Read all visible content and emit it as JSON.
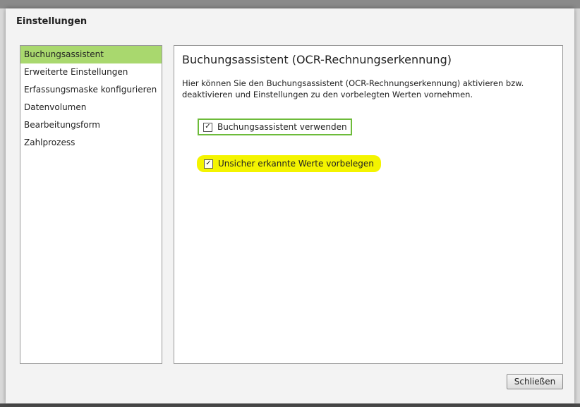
{
  "dialog": {
    "title": "Einstellungen"
  },
  "nav": {
    "items": [
      {
        "label": "Buchungsassistent",
        "active": true
      },
      {
        "label": "Erweiterte Einstellungen"
      },
      {
        "label": "Erfassungsmaske konfigurieren"
      },
      {
        "label": "Datenvolumen"
      },
      {
        "label": "Bearbeitungsform"
      },
      {
        "label": "Zahlprozess"
      }
    ]
  },
  "content": {
    "title": "Buchungsassistent (OCR-Rechnungserkennung)",
    "description": "Hier können Sie den Buchungsassistent (OCR-Rechnungserkennung) aktivieren bzw. deaktivieren und Einstellungen zu den vorbelegten Werten vornehmen.",
    "options": [
      {
        "label": "Buchungsassistent verwenden",
        "checked": true,
        "check_glyph": "✓"
      },
      {
        "label": "Unsicher erkannte Werte vorbelegen",
        "checked": true,
        "check_glyph": "✓"
      }
    ]
  },
  "footer": {
    "close_label": "Schließen"
  },
  "colors": {
    "active_nav": "#a9d86e",
    "option_border": "#6dbb3a",
    "highlight": "#f4f400"
  }
}
